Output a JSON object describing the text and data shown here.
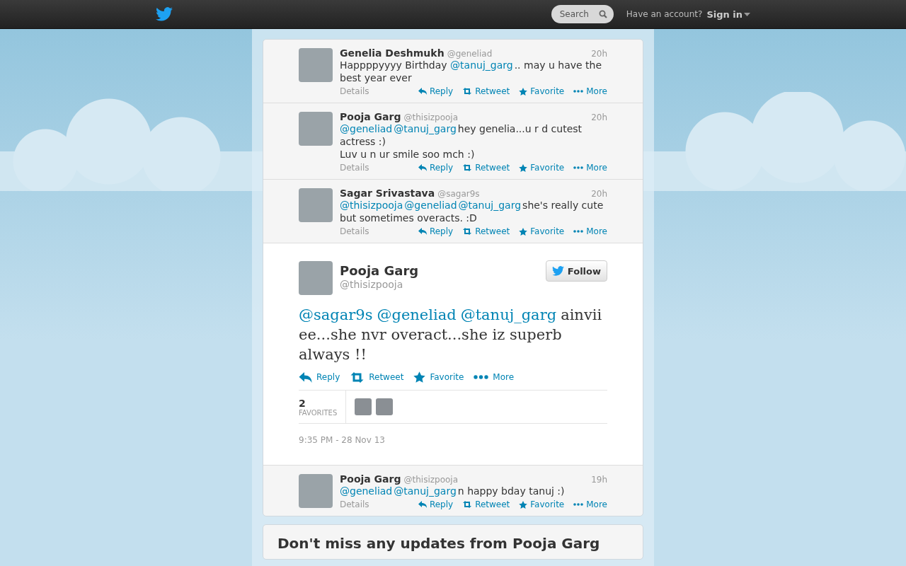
{
  "topbar": {
    "search": {
      "placeholder": "Search"
    },
    "account_prompt": "Have an account?",
    "sign_in": "Sign in"
  },
  "replies_before": [
    {
      "name": "Genelia Deshmukh",
      "handle": "@geneliad",
      "time": "20h",
      "parts": [
        {
          "kind": "text",
          "text": "Happppyyyy Birthday "
        },
        {
          "kind": "mention",
          "text": "@tanuj_garg"
        },
        {
          "kind": "text",
          "text": ".. may u have the best year ever"
        }
      ],
      "details": "Details",
      "actions": [
        {
          "kind": "reply",
          "label": "Reply"
        },
        {
          "kind": "retweet",
          "label": "Retweet"
        },
        {
          "kind": "favorite",
          "label": "Favorite"
        },
        {
          "kind": "more",
          "label": "More"
        }
      ]
    },
    {
      "name": "Pooja Garg",
      "handle": "@thisizpooja",
      "time": "20h",
      "parts": [
        {
          "kind": "mention",
          "text": "@geneliad"
        },
        {
          "kind": "mention",
          "text": "@tanuj_garg"
        },
        {
          "kind": "text",
          "text": "hey genelia...u r d cutest actress :)\nLuv u n ur smile soo mch :)"
        }
      ],
      "details": "Details",
      "actions": [
        {
          "kind": "reply",
          "label": "Reply"
        },
        {
          "kind": "retweet",
          "label": "Retweet"
        },
        {
          "kind": "favorite",
          "label": "Favorite"
        },
        {
          "kind": "more",
          "label": "More"
        }
      ]
    },
    {
      "name": "Sagar Srivastava",
      "handle": "@sagar9s",
      "time": "20h",
      "parts": [
        {
          "kind": "mention",
          "text": "@thisizpooja"
        },
        {
          "kind": "mention",
          "text": "@geneliad"
        },
        {
          "kind": "mention",
          "text": "@tanuj_garg"
        },
        {
          "kind": "text",
          "text": "she's really cute but sometimes overacts. :D"
        }
      ],
      "details": "Details",
      "actions": [
        {
          "kind": "reply",
          "label": "Reply"
        },
        {
          "kind": "retweet",
          "label": "Retweet"
        },
        {
          "kind": "favorite",
          "label": "Favorite"
        },
        {
          "kind": "more",
          "label": "More"
        }
      ]
    }
  ],
  "main_tweet": {
    "name": "Pooja Garg",
    "handle": "@thisizpooja",
    "follow": "Follow",
    "parts": [
      {
        "kind": "mention",
        "text": "@sagar9s"
      },
      {
        "kind": "mention",
        "text": "@geneliad"
      },
      {
        "kind": "mention",
        "text": "@tanuj_garg"
      },
      {
        "kind": "text",
        "text": "ainviiee...she nvr overact...she iz superb always !!"
      }
    ],
    "actions": [
      {
        "kind": "reply",
        "label": "Reply"
      },
      {
        "kind": "retweet",
        "label": "Retweet"
      },
      {
        "kind": "favorite",
        "label": "Favorite"
      },
      {
        "kind": "more",
        "label": "More"
      }
    ],
    "favorites_count": "2",
    "favorites_label": "FAVORITES",
    "timestamp": "9:35 PM - 28 Nov 13"
  },
  "replies_after": [
    {
      "name": "Pooja Garg",
      "handle": "@thisizpooja",
      "time": "19h",
      "parts": [
        {
          "kind": "mention",
          "text": "@geneliad"
        },
        {
          "kind": "mention",
          "text": "@tanuj_garg"
        },
        {
          "kind": "text",
          "text": "n happy bday tanuj :)"
        }
      ],
      "details": "Details",
      "actions": [
        {
          "kind": "reply",
          "label": "Reply"
        },
        {
          "kind": "retweet",
          "label": "Retweet"
        },
        {
          "kind": "favorite",
          "label": "Favorite"
        },
        {
          "kind": "more",
          "label": "More"
        }
      ]
    }
  ],
  "signup_card": {
    "heading": "Don't miss any updates from Pooja Garg"
  }
}
